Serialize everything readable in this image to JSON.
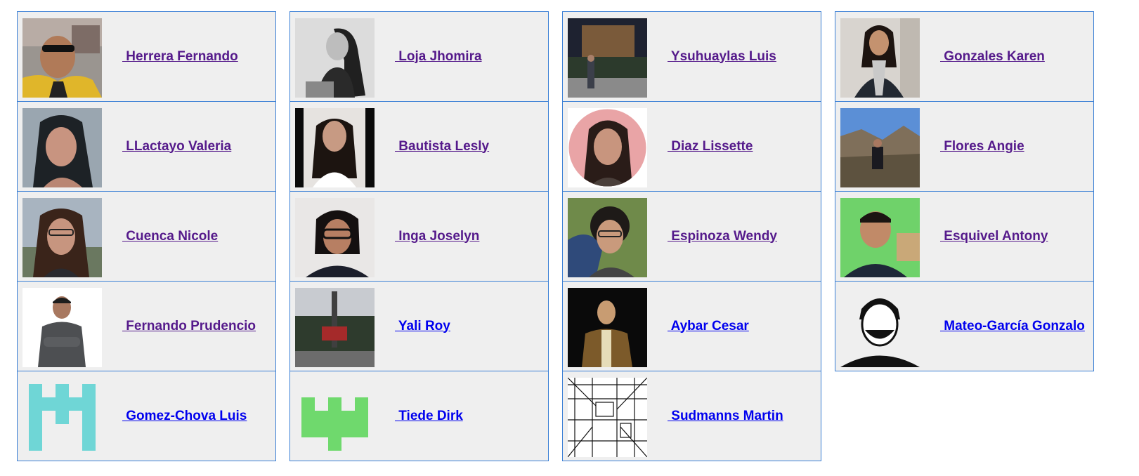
{
  "columns": [
    [
      {
        "name": " Herrera Fernando",
        "visited": true,
        "avatar": "photo-man-sunglasses-yellow-jacket"
      },
      {
        "name": " LLactayo Valeria",
        "visited": true,
        "avatar": "photo-woman-long-hair"
      },
      {
        "name": " Cuenca Nicole",
        "visited": true,
        "avatar": "photo-woman-glasses-outdoor"
      },
      {
        "name": " Fernando Prudencio",
        "visited": true,
        "avatar": "photo-man-arms-crossed"
      },
      {
        "name": " Gomez-Chova Luis",
        "visited": false,
        "avatar": "identicon-cyan"
      }
    ],
    [
      {
        "name": " Loja Jhomira",
        "visited": true,
        "avatar": "photo-woman-grayscale"
      },
      {
        "name": " Bautista Lesly",
        "visited": true,
        "avatar": "photo-woman-glasses-white-blouse"
      },
      {
        "name": " Inga Joselyn",
        "visited": true,
        "avatar": "photo-woman-glasses-dark-sweater"
      },
      {
        "name": " Yali Roy",
        "visited": false,
        "avatar": "photo-monument-forest"
      },
      {
        "name": " Tiede Dirk",
        "visited": false,
        "avatar": "identicon-green"
      }
    ],
    [
      {
        "name": " Ysuhuaylas Luis",
        "visited": true,
        "avatar": "photo-man-plaza-night"
      },
      {
        "name": " Diaz Lissette",
        "visited": true,
        "avatar": "photo-woman-circle-crop"
      },
      {
        "name": " Espinoza Wendy",
        "visited": true,
        "avatar": "photo-woman-curly-hair-glasses"
      },
      {
        "name": " Aybar Cesar",
        "visited": false,
        "avatar": "photo-man-plaid-shirt-night"
      },
      {
        "name": " Sudmanns Martin",
        "visited": false,
        "avatar": "photo-map-sketch"
      }
    ],
    [
      {
        "name": " Gonzales Karen",
        "visited": true,
        "avatar": "photo-woman-scarf-indoor"
      },
      {
        "name": " Flores Angie",
        "visited": true,
        "avatar": "photo-woman-canyon"
      },
      {
        "name": " Esquivel Antony",
        "visited": true,
        "avatar": "photo-man-green-wall"
      },
      {
        "name": " Mateo-García Gonzalo",
        "visited": false,
        "avatar": "illustration-man-portrait-bw"
      }
    ]
  ],
  "colors": {
    "card_bg": "#efefef",
    "border": "#3a7fd5",
    "link_visited": "#551a8b",
    "link_unvisited": "#0000ee"
  }
}
